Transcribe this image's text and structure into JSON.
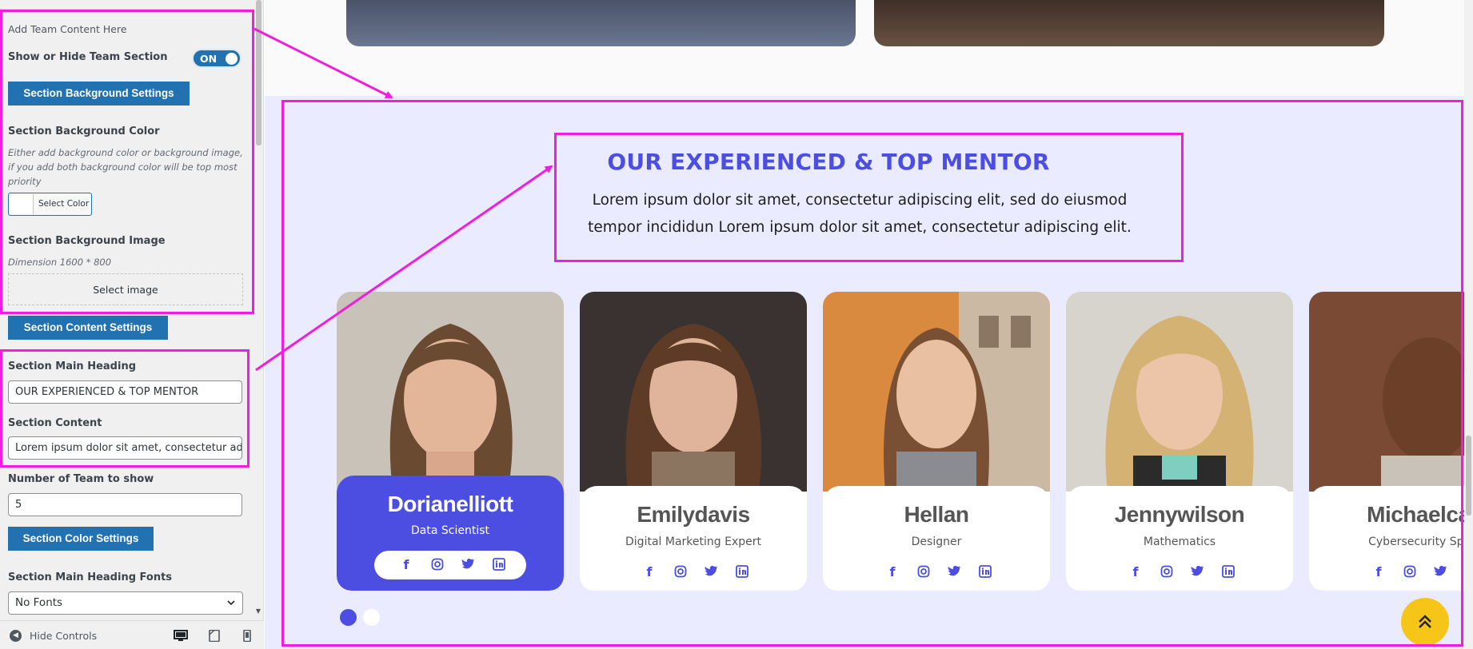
{
  "sidebar": {
    "section_intro": "Add Team Content Here",
    "show_hide_label": "Show or Hide Team Section",
    "toggle_state": "ON",
    "bg_settings_button": "Section Background Settings",
    "bg_color_label": "Section Background Color",
    "bg_color_desc": "Either add background color or background image, if you add both background color will be top most priority",
    "select_color_button": "Select Color",
    "bg_image_label": "Section Background Image",
    "bg_image_dimension": "Dimension 1600 * 800",
    "select_image_button": "Select image",
    "content_settings_button": "Section Content Settings",
    "main_heading_label": "Section Main Heading",
    "main_heading_value": "OUR EXPERIENCED & TOP MENTOR",
    "content_label": "Section Content",
    "content_value": "Lorem ipsum dolor sit amet, consectetur adipiscing elit",
    "team_count_label": "Number of Team to show",
    "team_count_value": "5",
    "color_settings_button": "Section Color Settings",
    "heading_fonts_label": "Section Main Heading Fonts",
    "heading_fonts_value": "No Fonts",
    "hide_controls": "Hide Controls",
    "device_icons": [
      "desktop-icon",
      "tablet-icon",
      "mobile-icon"
    ]
  },
  "preview": {
    "heading": "OUR EXPERIENCED & TOP MENTOR",
    "subtext": "Lorem ipsum dolor sit amet, consectetur adipiscing elit, sed do eiusmod tempor incididun Lorem ipsum dolor sit amet, consectetur adipiscing elit.",
    "team": [
      {
        "name": "Dorianelliott",
        "role": "Data Scientist",
        "active": true
      },
      {
        "name": "Emilydavis",
        "role": "Digital Marketing Expert",
        "active": false
      },
      {
        "name": "Hellan",
        "role": "Designer",
        "active": false
      },
      {
        "name": "Jennywilson",
        "role": "Mathematics",
        "active": false
      },
      {
        "name": "Michaelcar",
        "role": "Cybersecurity Spec",
        "active": false
      }
    ],
    "social_icons": [
      "facebook-icon",
      "instagram-icon",
      "twitter-icon",
      "linkedin-icon"
    ],
    "carousel_pages": 2,
    "carousel_active_page": 1
  },
  "colors": {
    "accent": "#4b4ee0",
    "annotation": "#f01edc",
    "wp_blue": "#2271b1",
    "section_bg": "#ebebff",
    "back_to_top": "#f5c518"
  }
}
